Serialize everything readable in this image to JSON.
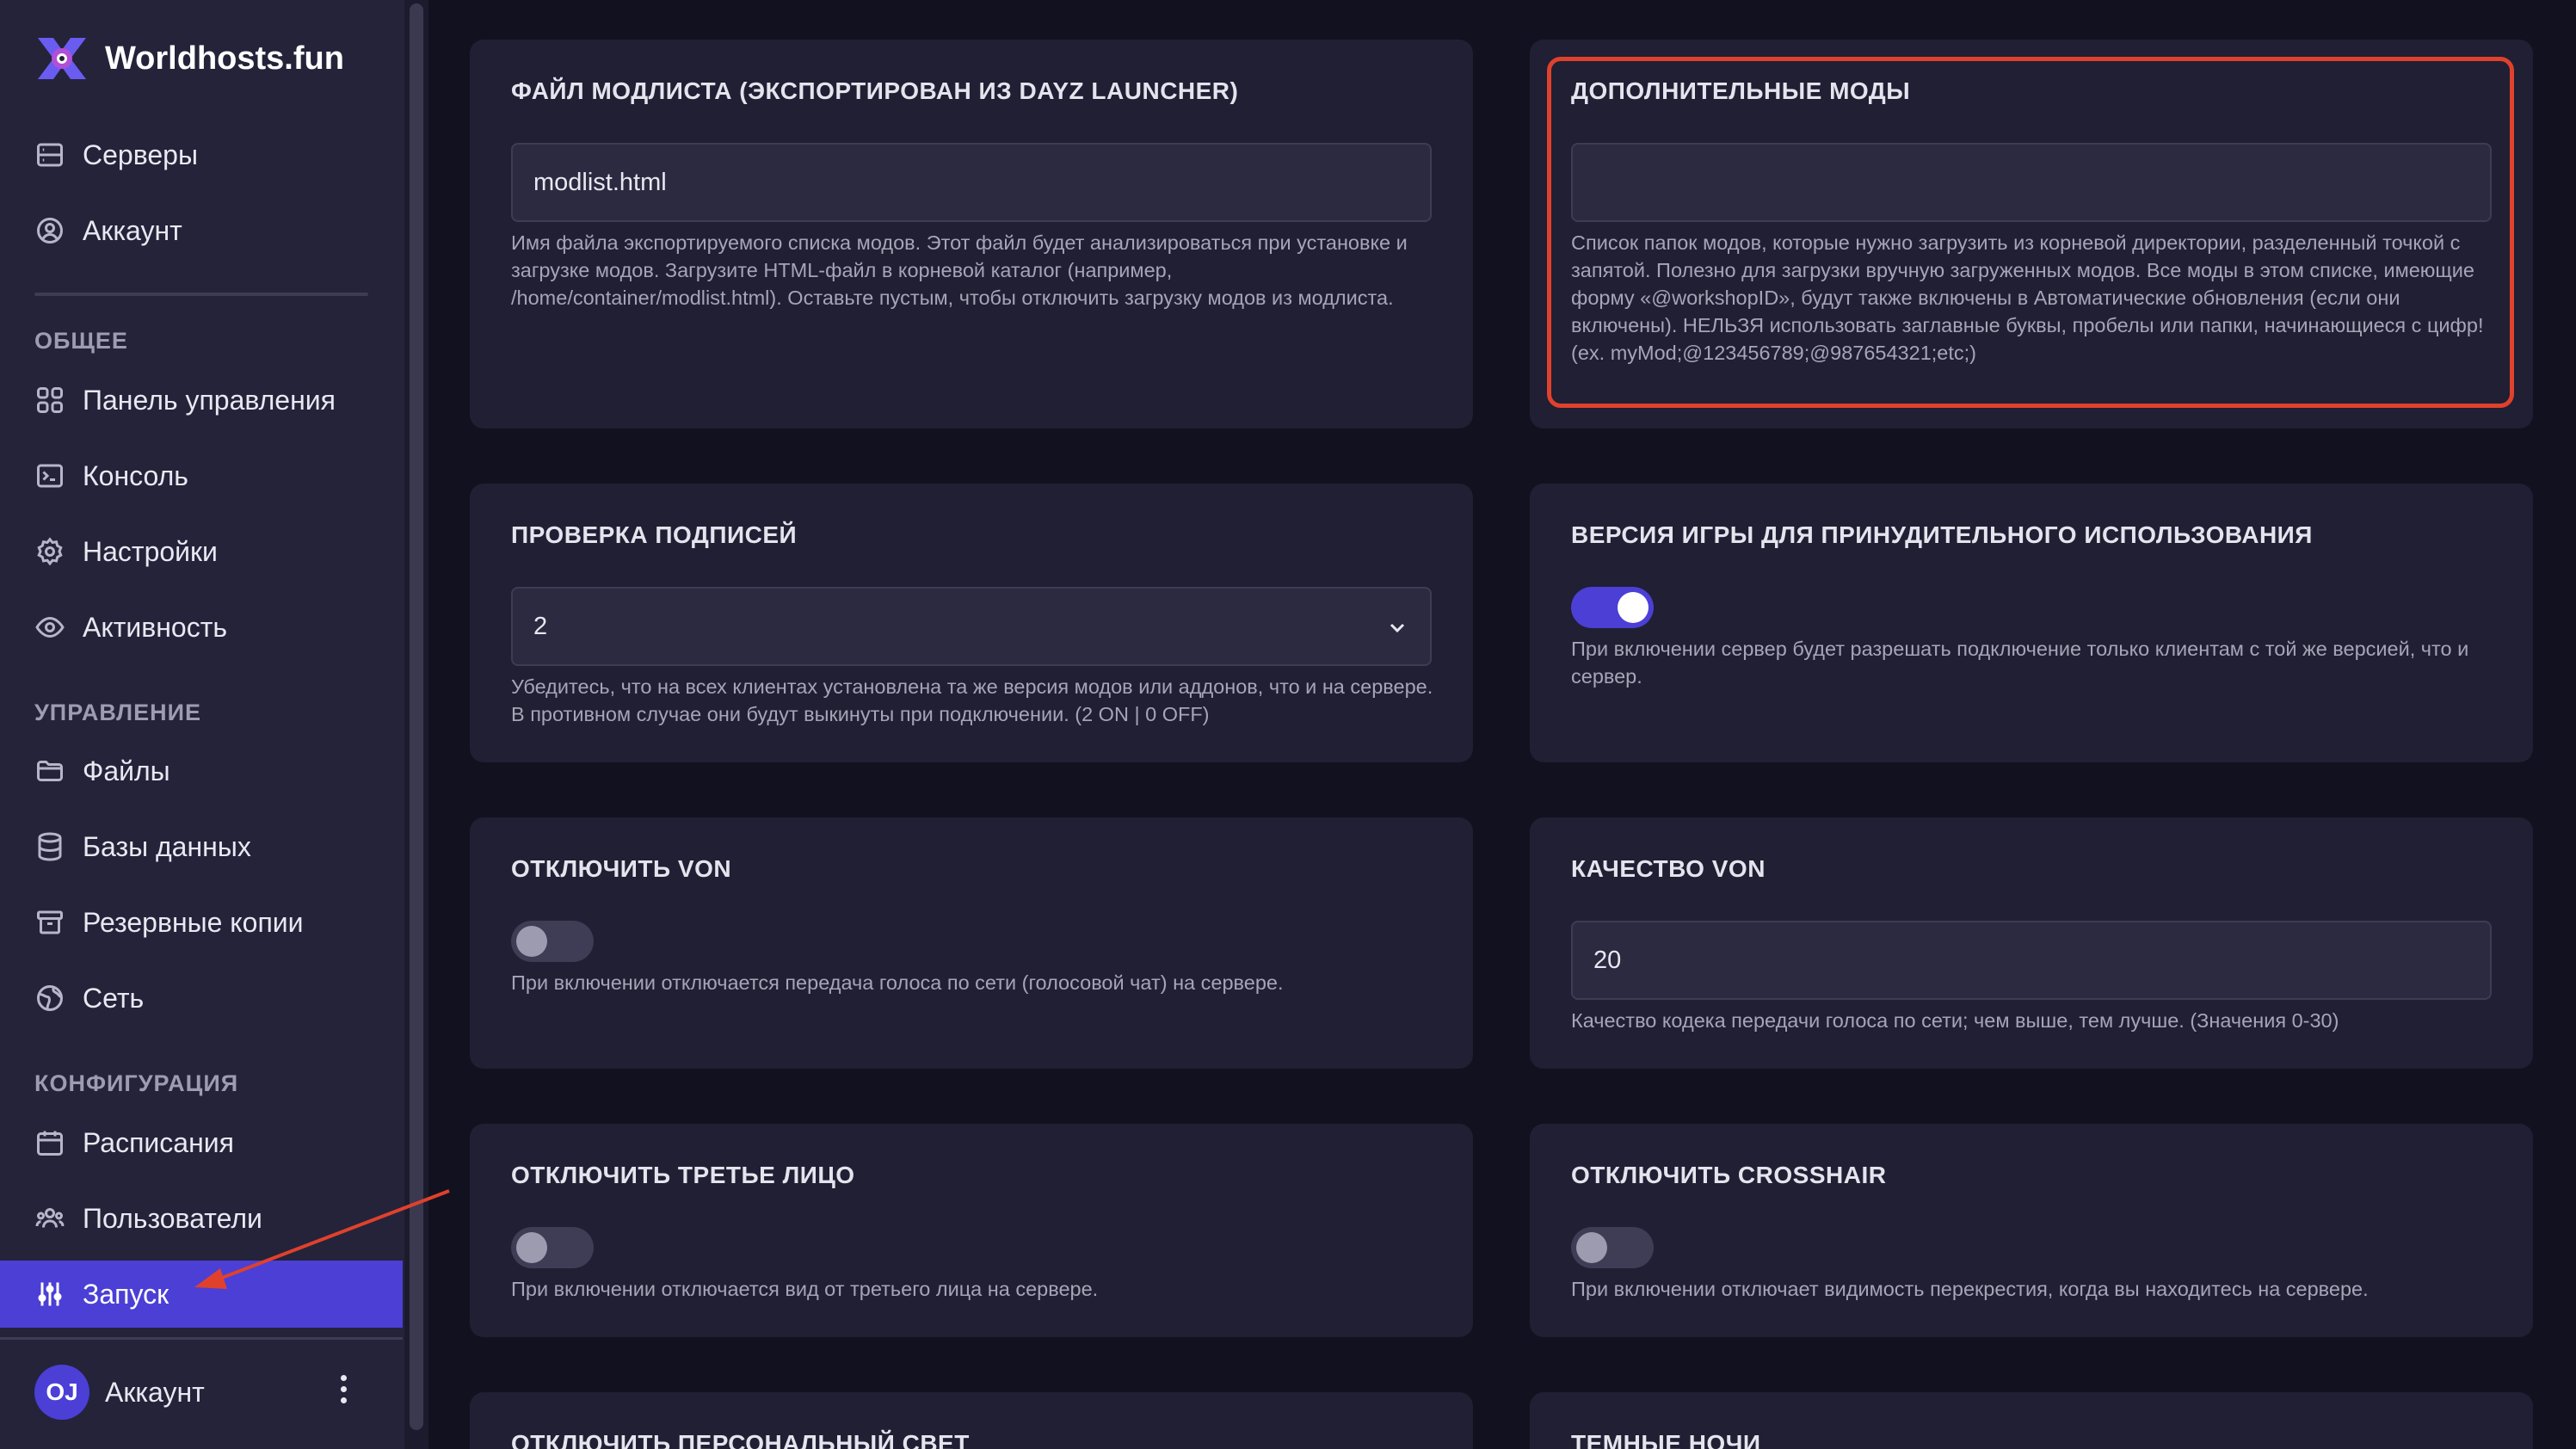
{
  "brand": {
    "name": "Worldhosts.fun"
  },
  "sidebar": {
    "top_items": [
      {
        "label": "Серверы",
        "icon": "server-icon"
      },
      {
        "label": "Аккаунт",
        "icon": "user-circle-icon"
      }
    ],
    "sections": [
      {
        "label": "ОБЩЕЕ",
        "items": [
          {
            "label": "Панель управления",
            "icon": "grid-icon"
          },
          {
            "label": "Консоль",
            "icon": "terminal-icon"
          },
          {
            "label": "Настройки",
            "icon": "gear-icon"
          },
          {
            "label": "Активность",
            "icon": "eye-icon"
          }
        ]
      },
      {
        "label": "УПРАВЛЕНИЕ",
        "items": [
          {
            "label": "Файлы",
            "icon": "folder-icon"
          },
          {
            "label": "Базы данных",
            "icon": "database-icon"
          },
          {
            "label": "Резервные копии",
            "icon": "archive-icon"
          },
          {
            "label": "Сеть",
            "icon": "globe-icon"
          }
        ]
      },
      {
        "label": "КОНФИГУРАЦИЯ",
        "items": [
          {
            "label": "Расписания",
            "icon": "calendar-icon"
          },
          {
            "label": "Пользователи",
            "icon": "users-icon"
          },
          {
            "label": "Запуск",
            "icon": "sliders-icon",
            "active": true
          }
        ]
      }
    ],
    "account": {
      "initials": "OJ",
      "label": "Аккаунт"
    }
  },
  "cards": {
    "modlist": {
      "title": "ФАЙЛ МОДЛИСТА (ЭКСПОРТИРОВАН ИЗ DAYZ LAUNCHER)",
      "value": "modlist.html",
      "help": "Имя файла экспортируемого списка модов. Этот файл будет анализироваться при установке и загрузке модов. Загрузите HTML-файл в корневой каталог (например, /home/container/modlist.html). Оставьте пустым, чтобы отключить загрузку модов из модлиста."
    },
    "extra_mods": {
      "title": "ДОПОЛНИТЕЛЬНЫЕ МОДЫ",
      "value": "",
      "help": "Список папок модов, которые нужно загрузить из корневой директории, разделенный точкой с запятой. Полезно для загрузки вручную загруженных модов. Все моды в этом списке, имеющие форму «@workshopID», будут также включены в Автоматические обновления (если они включены). НЕЛЬЗЯ использовать заглавные буквы, пробелы или папки, начинающиеся с цифр! (ex. myMod;@123456789;@987654321;etc;)"
    },
    "signature": {
      "title": "ПРОВЕРКА ПОДПИСЕЙ",
      "value": "2",
      "help": "Убедитесь, что на всех клиентах установлена та же версия модов или аддонов, что и на сервере. В противном случае они будут выкинуты при подключении. (2 ON | 0 OFF)"
    },
    "game_version": {
      "title": "ВЕРСИЯ ИГРЫ ДЛЯ ПРИНУДИТЕЛЬНОГО ИСПОЛЬЗОВАНИЯ",
      "enabled": true,
      "help": "При включении сервер будет разрешать подключение только клиентам с той же версией, что и сервер."
    },
    "disable_von": {
      "title": "ОТКЛЮЧИТЬ VON",
      "enabled": false,
      "help": "При включении отключается передача голоса по сети (голосовой чат) на сервере."
    },
    "von_quality": {
      "title": "КАЧЕСТВО VON",
      "value": "20",
      "help": "Качество кодека передачи голоса по сети; чем выше, тем лучше. (Значения 0-30)"
    },
    "third_person": {
      "title": "ОТКЛЮЧИТЬ ТРЕТЬЕ ЛИЦО",
      "enabled": false,
      "help": "При включении отключается вид от третьего лица на сервере."
    },
    "crosshair": {
      "title": "ОТКЛЮЧИТЬ CROSSHAIR",
      "enabled": false,
      "help": "При включении отключает видимость перекрестия, когда вы находитесь на сервере."
    },
    "personal_light": {
      "title": "ОТКЛЮЧИТЬ ПЕРСОНАЛЬНЫЙ СВЕТ"
    },
    "dark_nights": {
      "title": "ТЕМНЫЕ НОЧИ"
    }
  }
}
